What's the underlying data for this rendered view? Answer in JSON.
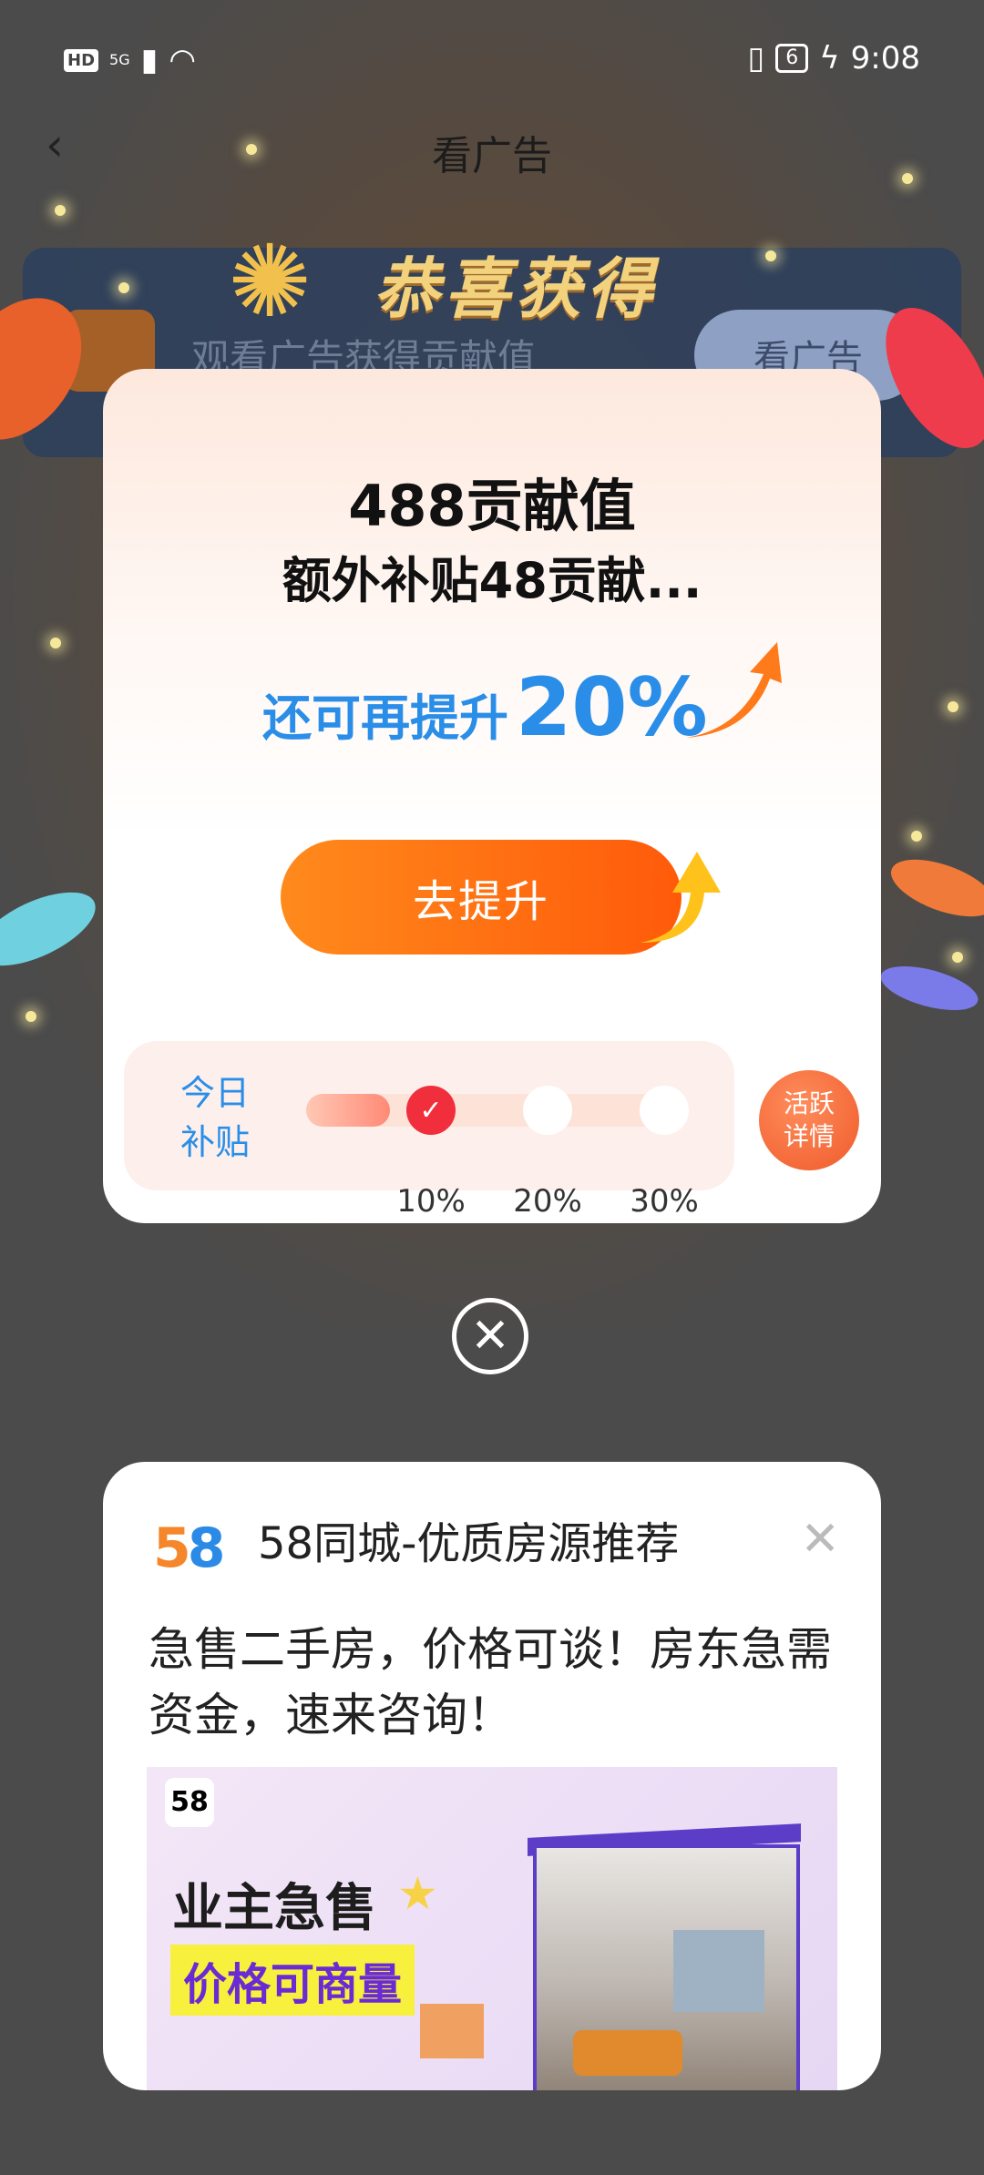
{
  "status_bar": {
    "left_badge": "HD",
    "network": "5G",
    "battery": "6",
    "time": "9:08"
  },
  "nav": {
    "title": "看广告",
    "back_icon": "chevron-left-icon"
  },
  "background_card": {
    "text": "观看广告获得贡献值",
    "button": "看广告"
  },
  "popup": {
    "banner": "恭喜获得",
    "value_line": "488贡献值",
    "extra_line": "额外补贴48贡献...",
    "boost_label": "还可再提升",
    "boost_percent": "20%",
    "boost_button": "去提升",
    "subsidy": {
      "label_line1": "今日",
      "label_line2": "补贴",
      "steps": [
        "10%",
        "20%",
        "30%"
      ],
      "completed_steps": 1,
      "progress_fraction": 0.22
    },
    "active_details_line1": "活跃",
    "active_details_line2": "详情"
  },
  "close_button_glyph": "✕",
  "ad": {
    "source": "58同城-优质房源推荐",
    "close_glyph": "✕",
    "logo_five": "5",
    "logo_eight": "8",
    "text": "急售二手房，价格可谈！房东急需资金，速来咨询！",
    "image": {
      "logo": "58",
      "title": "业主急售",
      "subtitle": "价格可商量"
    }
  },
  "colors": {
    "accent_blue": "#2a8ee8",
    "button_orange": "#ff6a12",
    "check_red": "#f02e3c"
  }
}
